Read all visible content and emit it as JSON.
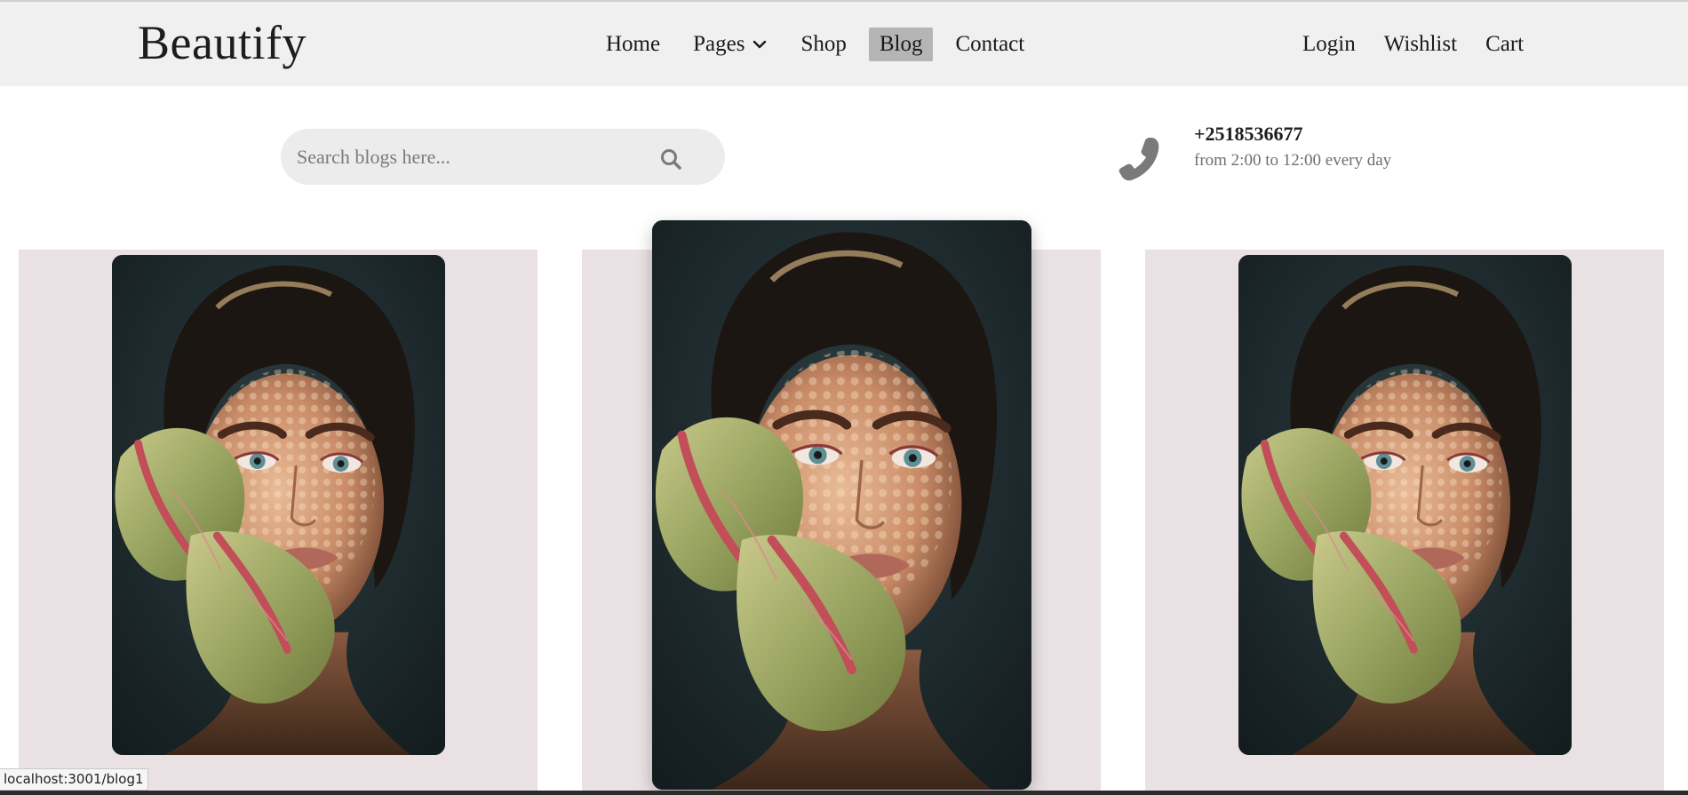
{
  "brand": "Beautify",
  "nav": {
    "main": [
      {
        "label": "Home"
      },
      {
        "label": "Pages"
      },
      {
        "label": "Shop"
      },
      {
        "label": "Blog"
      },
      {
        "label": "Contact"
      }
    ],
    "right": [
      {
        "label": "Login"
      },
      {
        "label": "Wishlist"
      },
      {
        "label": "Cart"
      }
    ],
    "active": "Blog"
  },
  "search": {
    "placeholder": "Search blogs here...",
    "value": ""
  },
  "contact": {
    "phone": "+2518536677",
    "hours": "from 2:00 to 12:00 every day"
  },
  "blog_cards": [
    {
      "image": "portrait-with-anthurium-flowers"
    },
    {
      "image": "portrait-with-anthurium-flowers",
      "state": "hovered"
    },
    {
      "image": "portrait-with-anthurium-flowers"
    }
  ],
  "status_bar": {
    "url": "localhost:3001/blog1"
  },
  "colors": {
    "header_bg": "#f0f0f0",
    "active_nav_bg": "#b5b5b5",
    "search_bg": "#ececec",
    "card_bg": "#e9e1e3",
    "icon_gray": "#7a7a7a"
  },
  "icons": {
    "dropdown": "chevron-down-icon",
    "search": "search-icon",
    "phone": "phone-icon"
  }
}
